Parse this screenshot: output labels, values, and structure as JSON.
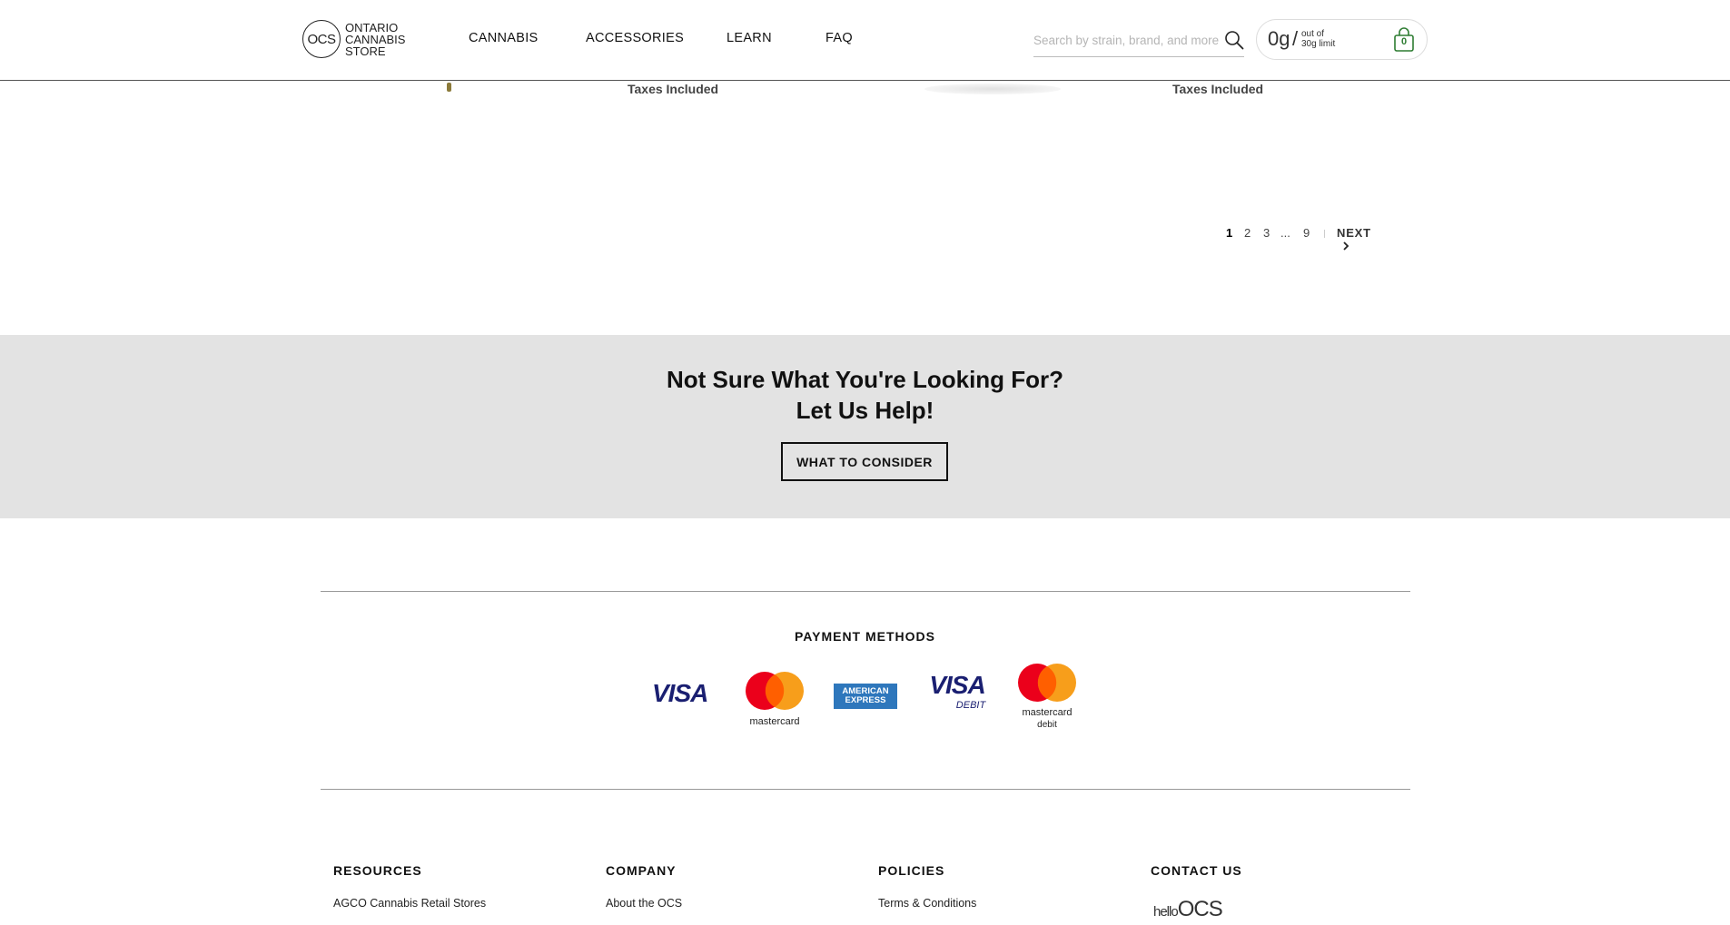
{
  "header": {
    "logo": {
      "mark": "OCS",
      "lines": [
        "ONTARIO",
        "CANNABIS",
        "STORE"
      ]
    },
    "nav": [
      "CANNABIS",
      "ACCESSORIES",
      "LEARN",
      "FAQ"
    ],
    "search": {
      "placeholder": "Search by strain, brand, and more",
      "value": ""
    },
    "purchase_limit": {
      "amount": "0g",
      "slash": "/",
      "line1": "out of",
      "line2": "30g limit"
    },
    "cart_count": "0"
  },
  "products": {
    "tax_note_left": "Taxes Included",
    "tax_note_right": "Taxes Included"
  },
  "pagination": {
    "pages": [
      "1",
      "2",
      "3",
      "...",
      "9"
    ],
    "current": "1",
    "next_label": "NEXT"
  },
  "help": {
    "title_line1": "Not Sure What You're Looking For?",
    "title_line2": "Let Us Help!",
    "button_label": "WHAT TO CONSIDER"
  },
  "payment": {
    "title": "PAYMENT METHODS",
    "cards": [
      {
        "name": "visa",
        "text": "VISA"
      },
      {
        "name": "mastercard",
        "text": "mastercard"
      },
      {
        "name": "american-express",
        "text_line1": "AMERICAN",
        "text_line2": "EXPRESS"
      },
      {
        "name": "visa-debit",
        "text": "VISA",
        "subtext": "DEBIT"
      },
      {
        "name": "mastercard-debit",
        "text": "mastercard",
        "subtext": "debit"
      }
    ]
  },
  "footer": {
    "columns": [
      {
        "heading": "RESOURCES",
        "link": "AGCO Cannabis Retail Stores"
      },
      {
        "heading": "COMPANY",
        "link": "About the OCS"
      },
      {
        "heading": "POLICIES",
        "link": "Terms & Conditions"
      },
      {
        "heading": "CONTACT US",
        "brand_line1": "hello",
        "brand_line2": "OCS"
      }
    ]
  },
  "colors": {
    "help_band": "#e3e3e3",
    "visa_blue": "#1a1f71",
    "visa_gold": "#f7b600",
    "mc_red": "#eb001b",
    "mc_orange": "#f79e1b",
    "amex_blue": "#2e77bc",
    "cart_green": "#2e7d32"
  }
}
